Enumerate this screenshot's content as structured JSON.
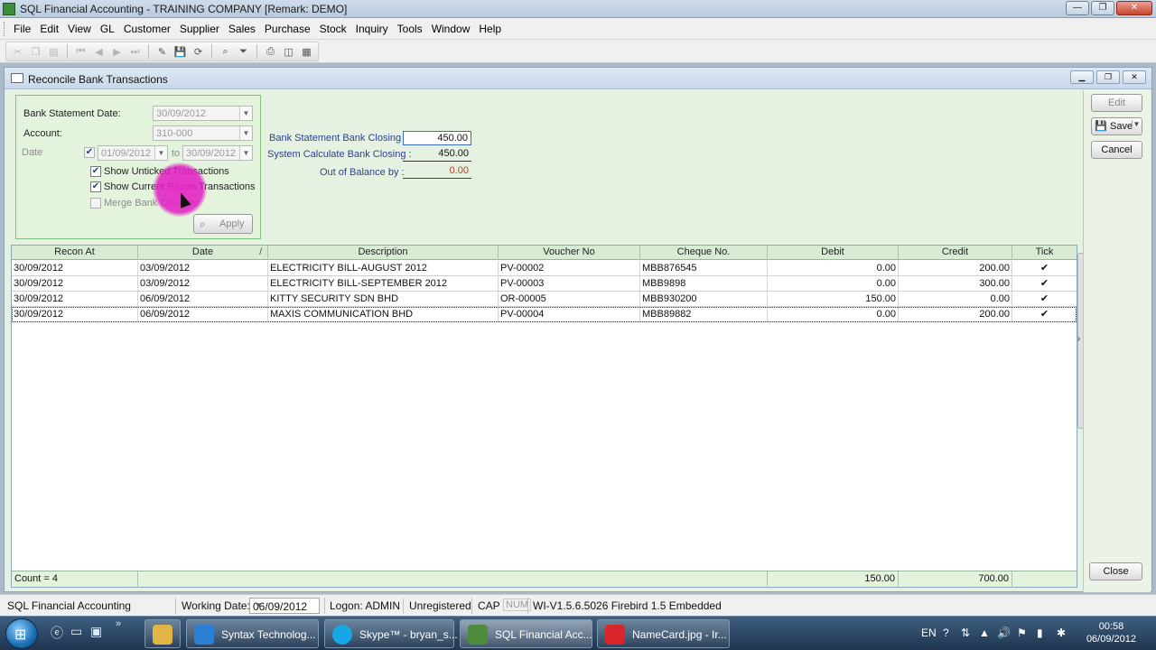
{
  "window": {
    "title": "SQL Financial Accounting - TRAINING COMPANY [Remark: DEMO]",
    "controls": {
      "minimize": "—",
      "maximize": "❐",
      "close": "✕"
    }
  },
  "menu": [
    "File",
    "Edit",
    "View",
    "GL",
    "Customer",
    "Supplier",
    "Sales",
    "Purchase",
    "Stock",
    "Inquiry",
    "Tools",
    "Window",
    "Help"
  ],
  "toolbar": {
    "icons": [
      "cut-icon",
      "copy-icon",
      "paste-icon",
      "first-record-icon",
      "prior-record-icon",
      "next-record-icon",
      "last-record-icon",
      "edit-icon",
      "save-icon",
      "refresh-icon",
      "find-icon",
      "filter-icon",
      "print-icon",
      "preview-icon",
      "design-icon"
    ]
  },
  "child": {
    "title": "Reconcile Bank Transactions",
    "filter": {
      "statement_date_label": "Bank Statement Date:",
      "statement_date_value": "30/09/2012",
      "account_label": "Account:",
      "account_value": "310-000",
      "date_label": "Date",
      "date_from": "01/09/2012",
      "to_label": "to",
      "date_to": "30/09/2012",
      "show_unticked": "Show Unticked Transactions",
      "show_current": "Show Current Recon Transactions",
      "merge_charges": "Merge Bank Charges",
      "apply": "Apply"
    },
    "balance": {
      "bank_closing_label": "Bank Statement  Bank Closing :",
      "bank_closing_value": "450.00",
      "system_closing_label": "System Calculate Bank Closing :",
      "system_closing_value": "450.00",
      "out_of_balance_label": "Out of Balance by :",
      "out_of_balance_value": "0.00"
    },
    "actions": {
      "edit": "Edit",
      "save": "Save",
      "cancel": "Cancel",
      "close": "Close"
    },
    "grid": {
      "columns": [
        "Recon At",
        "Date",
        "Description",
        "Voucher No",
        "Cheque No.",
        "Debit",
        "Credit",
        "Tick"
      ],
      "sort_marker": "/",
      "rows": [
        [
          "30/09/2012",
          "03/09/2012",
          "ELECTRICITY BILL-AUGUST 2012",
          "PV-00002",
          "MBB876545",
          "0.00",
          "200.00",
          "✔"
        ],
        [
          "30/09/2012",
          "03/09/2012",
          "ELECTRICITY BILL-SEPTEMBER 2012",
          "PV-00003",
          "MBB9898",
          "0.00",
          "300.00",
          "✔"
        ],
        [
          "30/09/2012",
          "06/09/2012",
          "KITTY SECURITY SDN BHD",
          "OR-00005",
          "MBB930200",
          "150.00",
          "0.00",
          "✔"
        ],
        [
          "30/09/2012",
          "06/09/2012",
          "MAXIS COMMUNICATION BHD",
          "PV-00004",
          "MBB89882",
          "0.00",
          "200.00",
          "✔"
        ]
      ],
      "footer": {
        "count": "Count = 4",
        "debit_total": "150.00",
        "credit_total": "700.00"
      }
    }
  },
  "statusbar": {
    "app": "SQL Financial Accounting",
    "working_date_label": "Working Date:",
    "working_date": "06/09/2012",
    "logon": "Logon: ADMIN",
    "registration": "Unregistered",
    "caps": "CAP",
    "num": "NUM",
    "version": "WI-V1.5.6.5026 Firebird 1.5 Embedded"
  },
  "taskbar": {
    "tasks": [
      {
        "label": "Syntax Technolog...",
        "icon": "ie-icon",
        "color": "#2b7fd4"
      },
      {
        "label": "Skype™ - bryan_s...",
        "icon": "skype-icon",
        "color": "#19a6e6"
      },
      {
        "label": "SQL Financial Acc...",
        "icon": "sql-accounting-icon",
        "color": "#4c8c3c"
      },
      {
        "label": "NameCard.jpg - Ir...",
        "icon": "irfanview-icon",
        "color": "#d9262a"
      }
    ],
    "lang": "EN",
    "time": "00:58",
    "date": "06/09/2012"
  },
  "colors": {
    "accent": "#3a6dc0",
    "form_bg": "#e6f2e1",
    "filter_border": "#7ec47a",
    "out_of_balance": "#c0392b"
  }
}
